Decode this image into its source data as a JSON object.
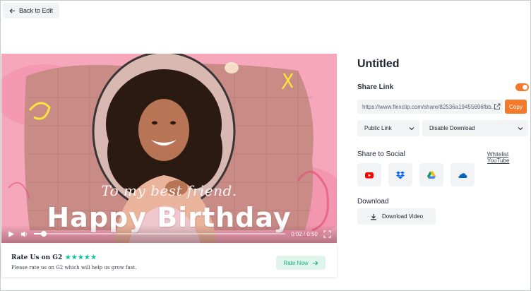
{
  "back_button": {
    "label": "Back to Edit",
    "icon": "arrow-left-icon"
  },
  "video": {
    "overlay_line1": "To my best friend.",
    "overlay_line2": "Happy Birthday",
    "time": "0:02 / 0:50",
    "progress": 0.04
  },
  "rate": {
    "title": "Rate Us on G2",
    "stars": "★★★★★",
    "subtitle": "Please rate us on G2 which will help us grow fast.",
    "button": "Rate Now"
  },
  "panel": {
    "title": "Untitled",
    "share_link_label": "Share Link",
    "share_link_enabled": true,
    "link_url": "https://www.flexclip.com/share/82536a19455696fbb...",
    "copy_button": "Copy",
    "visibility_select": "Public Link",
    "download_select": "Disable Download",
    "share_social_label": "Share to Social",
    "whitelist_link": "Whitelist YouTube",
    "social_icons": [
      "youtube-icon",
      "dropbox-icon",
      "google-drive-icon",
      "onedrive-icon"
    ],
    "download_label": "Download",
    "download_button": "Download Video"
  },
  "colors": {
    "accent": "#f37a2b",
    "video_pink": "#f4a8bb",
    "rate_green": "#17b079"
  }
}
